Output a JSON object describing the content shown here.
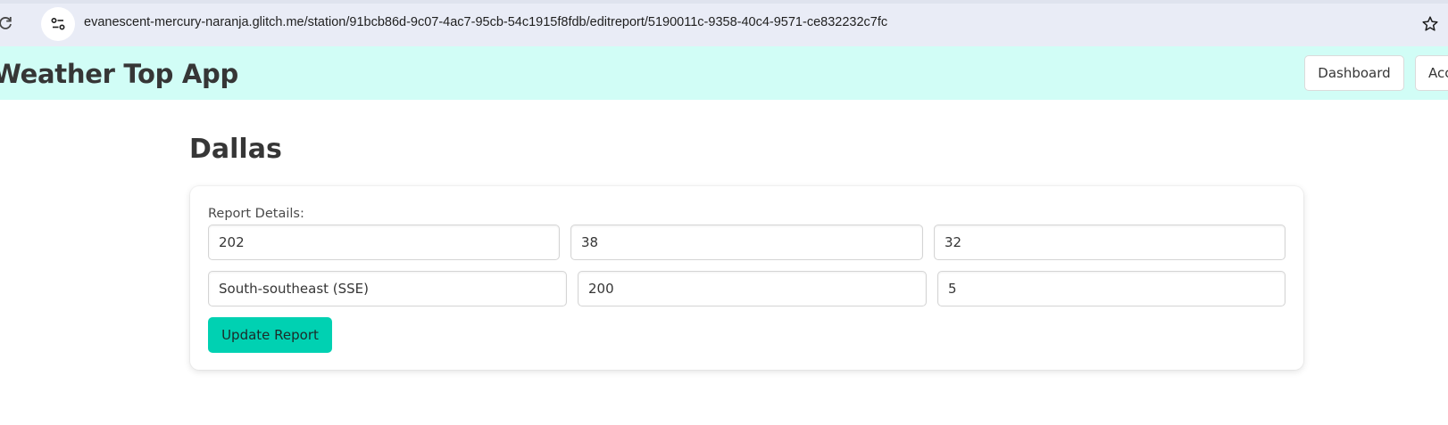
{
  "browser": {
    "url": "evanescent-mercury-naranja.glitch.me/station/91bcb86d-9c07-4ac7-95cb-54c1915f8fdb/editreport/5190011c-9358-40c4-9571-ce832232c7fc",
    "icons": {
      "reload": "reload-icon",
      "site_info": "tune-icon",
      "bookmark": "star-icon"
    }
  },
  "header": {
    "title": "Weather Top App",
    "nav": {
      "dashboard": "Dashboard",
      "account": "Account"
    },
    "background": "#d1fdf6"
  },
  "station": {
    "name": "Dallas"
  },
  "form": {
    "label": "Report Details:",
    "fields": {
      "code": "202",
      "temperature": "38",
      "wind_speed": "32",
      "wind_direction": "South-southeast (SSE)",
      "wind_degree": "200",
      "pressure": "5"
    },
    "submit_label": "Update Report",
    "accent": "#00d1b2"
  }
}
